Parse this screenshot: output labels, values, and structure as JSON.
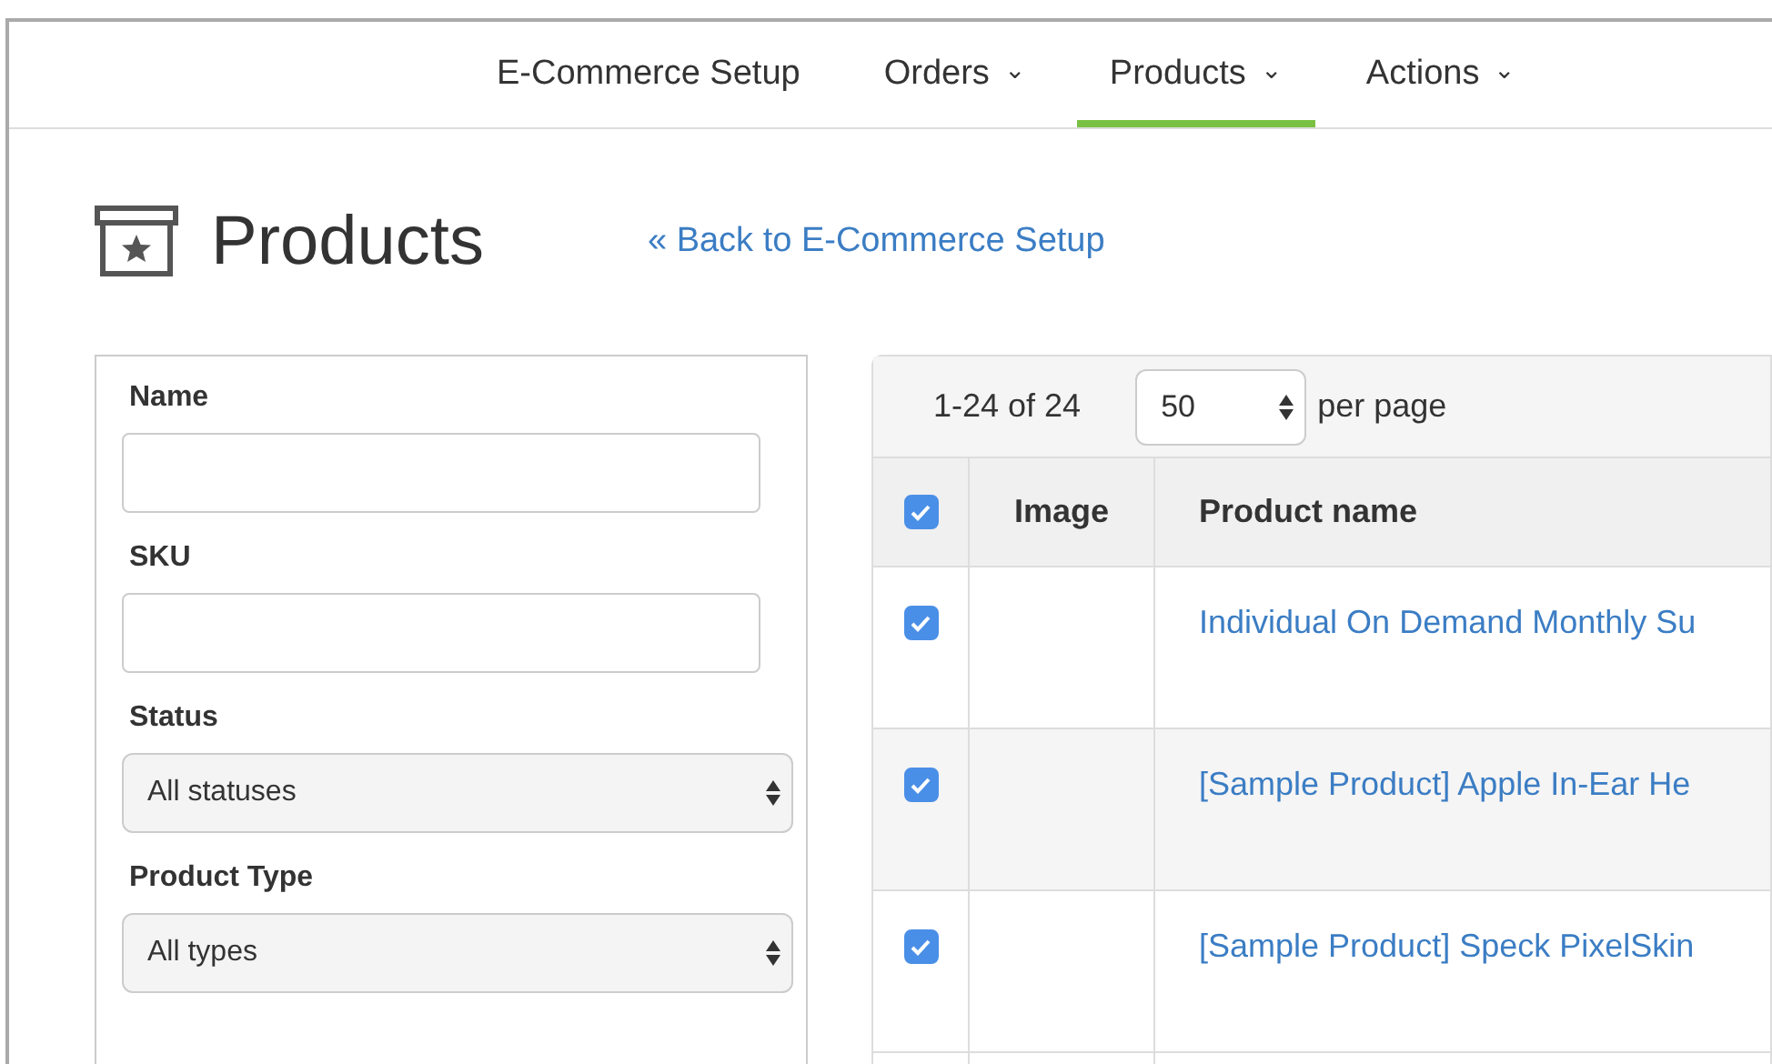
{
  "nav": [
    {
      "label": "E-Commerce Setup",
      "dropdown": false,
      "selected": false
    },
    {
      "label": "Orders",
      "dropdown": true,
      "selected": false
    },
    {
      "label": "Products",
      "dropdown": true,
      "selected": true
    },
    {
      "label": "Actions",
      "dropdown": true,
      "selected": false
    }
  ],
  "dropdown_glyph": "⌄",
  "page": {
    "title": "Products",
    "back_link": "« Back to E-Commerce Setup"
  },
  "filters": [
    {
      "kind": "text",
      "label": "Name"
    },
    {
      "kind": "text",
      "label": "SKU"
    },
    {
      "kind": "select",
      "label": "Status",
      "value": "All statuses"
    },
    {
      "kind": "select",
      "label": "Product Type",
      "value": "All types"
    }
  ],
  "table": {
    "range": "1-24 of 24",
    "per_page_value": "50",
    "per_page_label": "per page",
    "select_all_checked": true,
    "columns": [
      "Image",
      "Product name"
    ],
    "rows": [
      {
        "checked": true,
        "name": "Individual On Demand Monthly Su"
      },
      {
        "checked": true,
        "name": "[Sample Product] Apple In-Ear He"
      },
      {
        "checked": true,
        "name": "[Sample Product] Speck PixelSkin"
      }
    ]
  }
}
